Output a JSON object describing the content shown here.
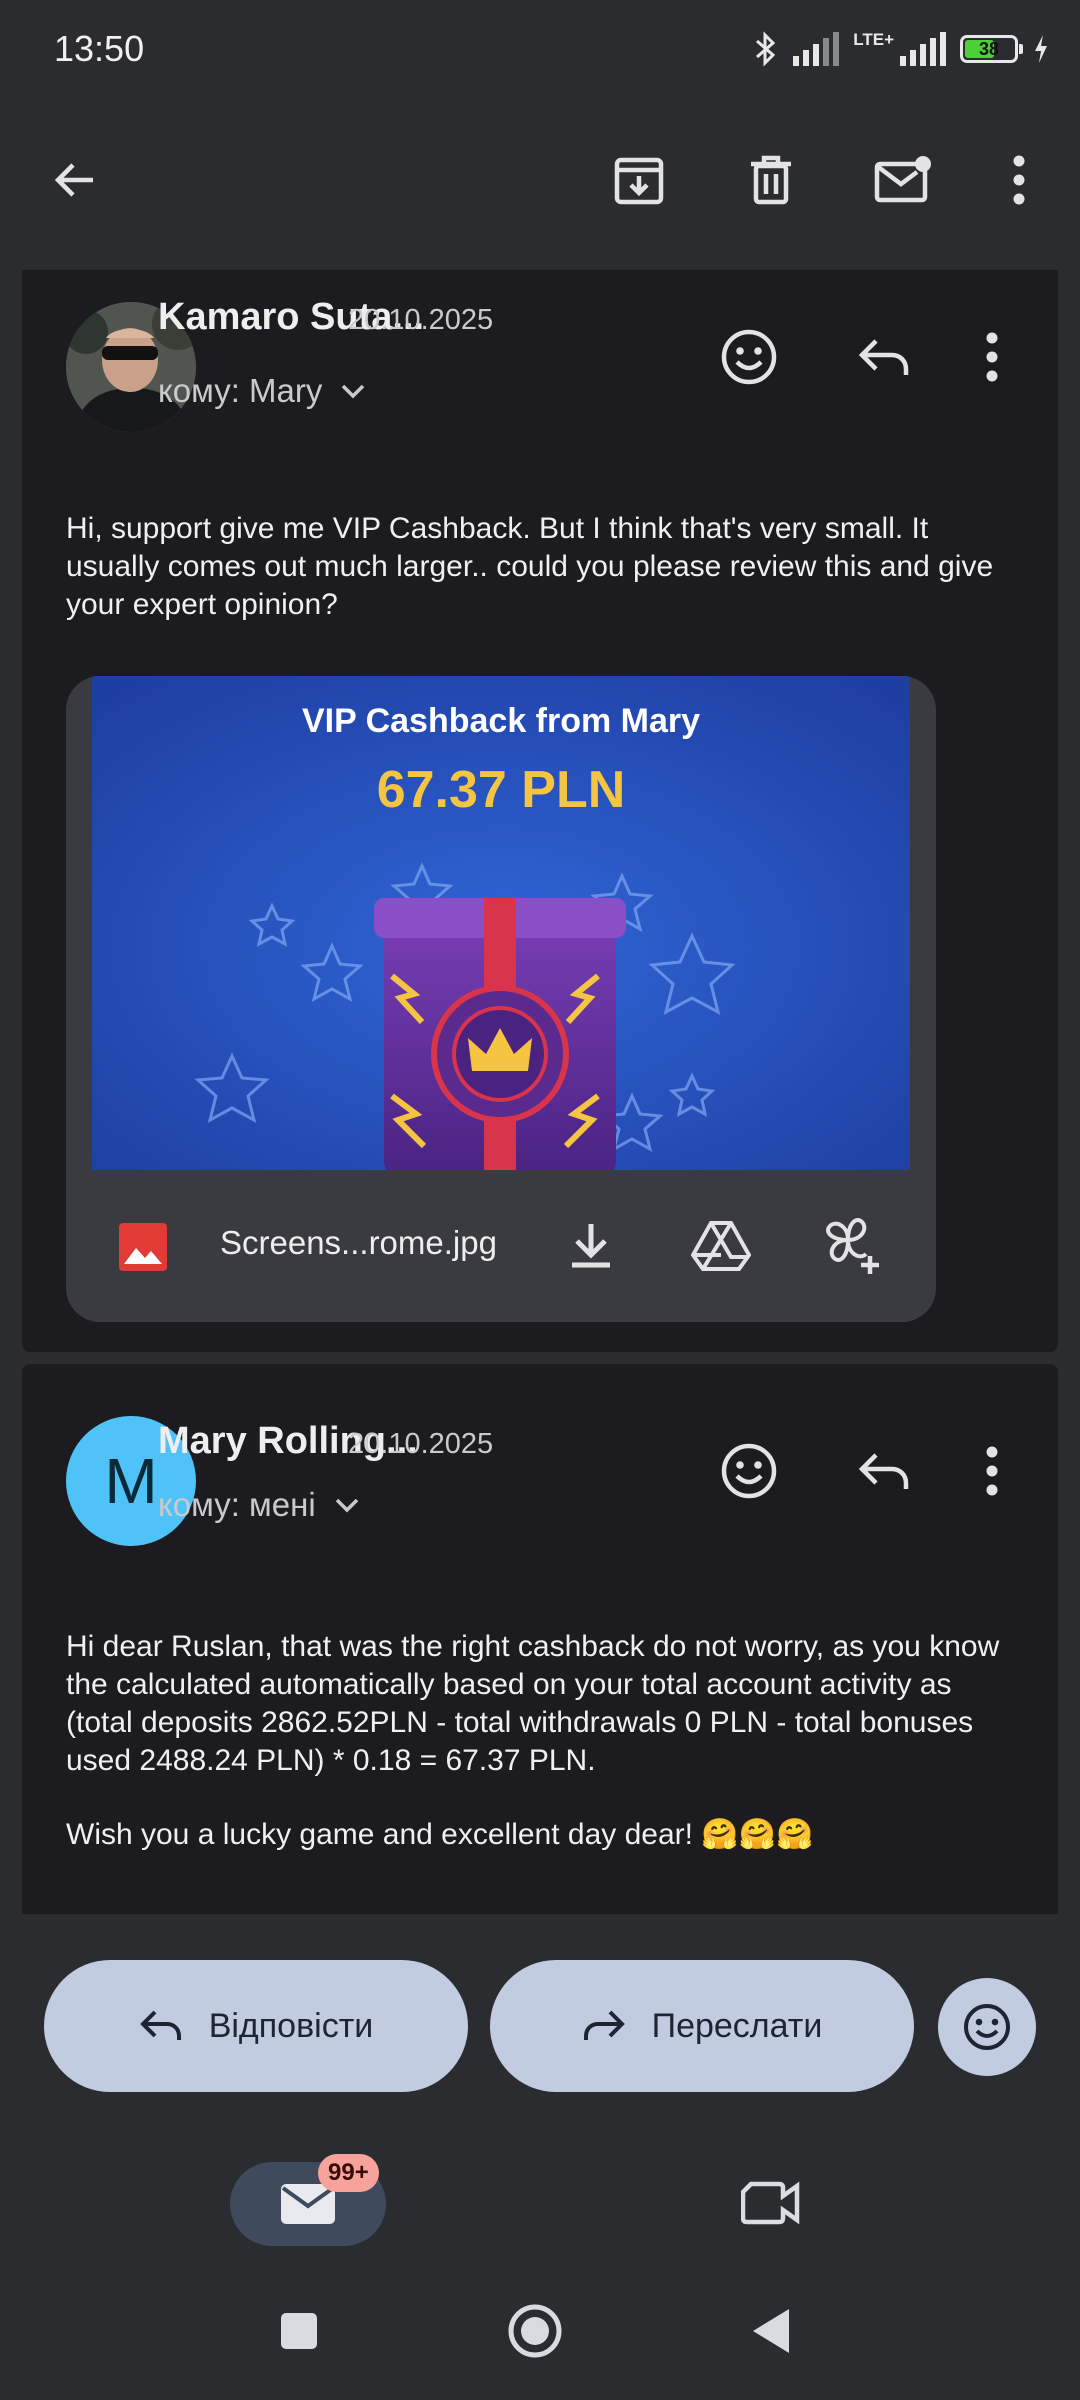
{
  "status_bar": {
    "time": "13:50",
    "network": "LTE+",
    "battery_level": "38"
  },
  "app_bar": {
    "back_icon": "arrow-left-icon",
    "actions": [
      "archive-icon",
      "delete-icon",
      "mark-unread-icon",
      "more-vert-icon"
    ]
  },
  "messages": [
    {
      "sender": "Kamaro Suta...",
      "date": "20.10.2025",
      "to": "кому: Mary",
      "body": "Hi, support give me VIP Cashback. But I think that's very small. It usually comes out much larger.. could you please review this and give your expert opinion?",
      "attachment": {
        "preview_title": "VIP Cashback from Mary",
        "preview_amount": "67.37 PLN",
        "file_name": "Screens...rome.jpg"
      }
    },
    {
      "sender": "Mary Rolling...",
      "avatar_letter": "M",
      "date": "20.10.2025",
      "to": "кому: мені",
      "body": "Hi dear Ruslan, that was the right cashback do not worry, as you know the calculated automatically based on your total account activity as (total deposits 2862.52PLN -  total withdrawals 0 PLN - total bonuses used 2488.24 PLN) * 0.18 = 67.37 PLN.",
      "body2": "Wish you a lucky game and excellent day dear! 🤗🤗🤗"
    }
  ],
  "actions": {
    "reply": "Відповісти",
    "forward": "Переслати"
  },
  "bottom_nav": {
    "mail_badge": "99+"
  },
  "colors": {
    "background": "#2b2c30",
    "card": "#1b1b20",
    "pill": "#c2cce0",
    "avatar_m": "#4fc3f7",
    "badge": "#f7a39b",
    "preview_gold": "#f5c542"
  }
}
